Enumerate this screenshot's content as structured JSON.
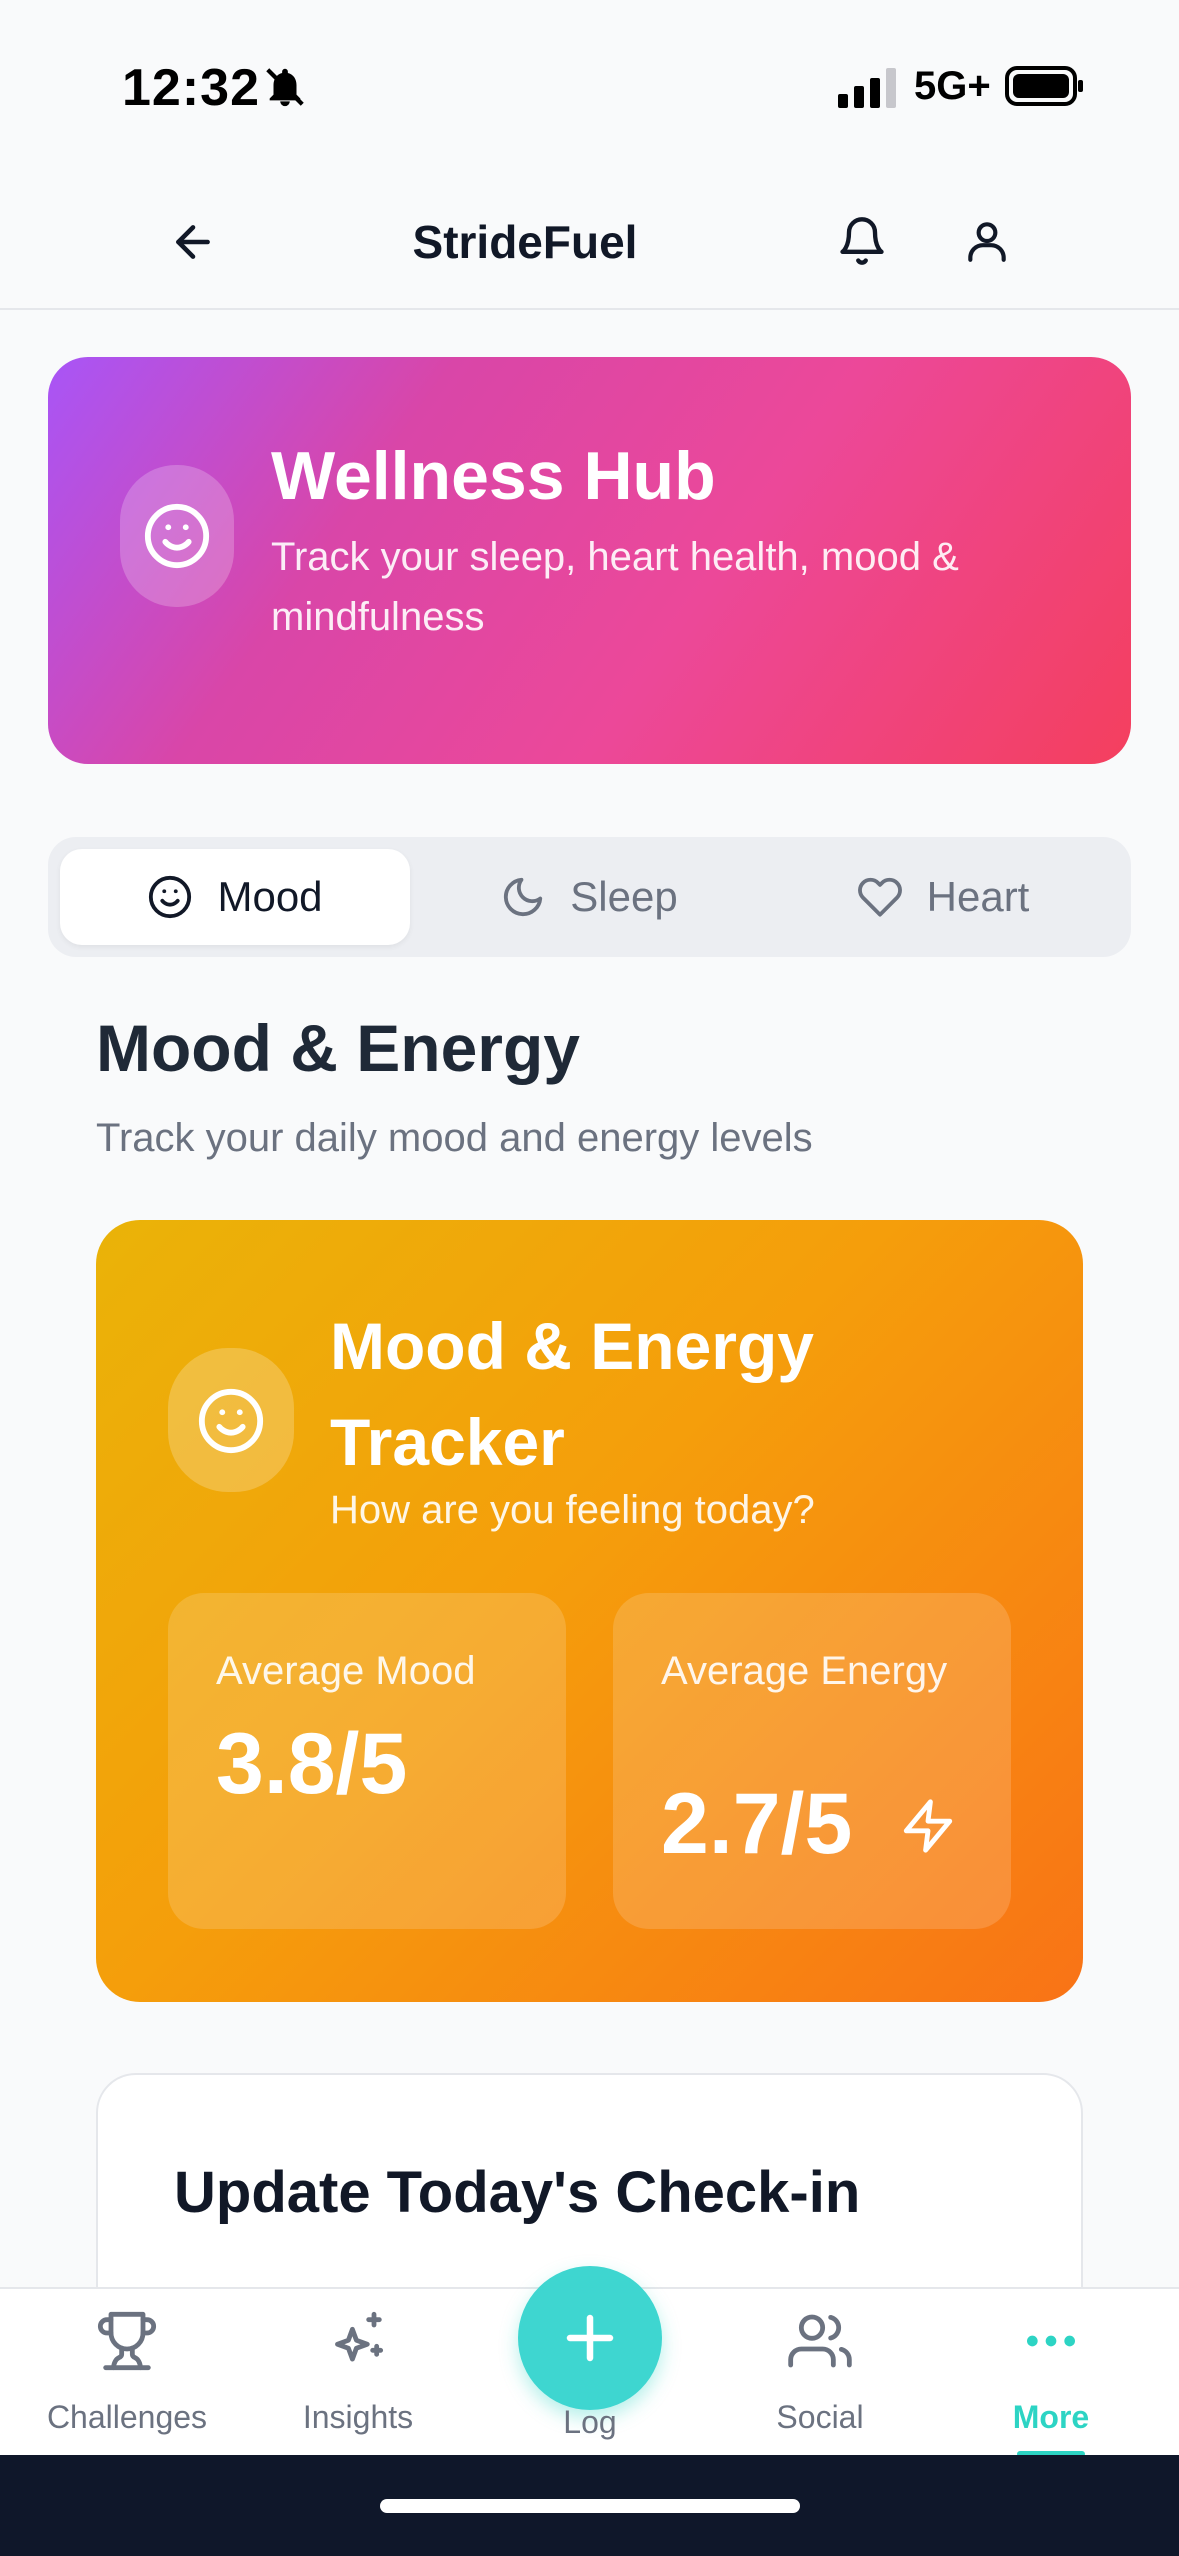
{
  "status_bar": {
    "time": "12:32",
    "network": "5G+"
  },
  "header": {
    "title": "StrideFuel"
  },
  "hero": {
    "title": "Wellness Hub",
    "subtitle": "Track your sleep, heart health, mood & mindfulness"
  },
  "tabs": [
    {
      "label": "Mood",
      "icon": "smile-icon",
      "active": true
    },
    {
      "label": "Sleep",
      "icon": "moon-icon",
      "active": false
    },
    {
      "label": "Heart",
      "icon": "heart-icon",
      "active": false
    }
  ],
  "section": {
    "title": "Mood & Energy",
    "subtitle": "Track your daily mood and energy levels"
  },
  "tracker": {
    "title": "Mood & Energy Tracker",
    "subtitle": "How are you feeling today?",
    "metrics": [
      {
        "label": "Average Mood",
        "value": "3.8/5"
      },
      {
        "label": "Average Energy",
        "value": "2.7/5"
      }
    ]
  },
  "checkin": {
    "title": "Update Today's Check-in"
  },
  "bottom_nav": {
    "items": [
      {
        "label": "Challenges",
        "icon": "trophy-icon"
      },
      {
        "label": "Insights",
        "icon": "sparkles-icon"
      },
      {
        "label": "Log",
        "icon": "plus-icon"
      },
      {
        "label": "Social",
        "icon": "users-icon"
      },
      {
        "label": "More",
        "icon": "more-dots-icon",
        "active": true
      }
    ]
  },
  "colors": {
    "accent": "#2dd4c4",
    "hero_gradient": [
      "#a855f7",
      "#ec4899",
      "#f43f5e"
    ],
    "tracker_gradient": [
      "#eab308",
      "#f59e0b",
      "#f97316"
    ]
  }
}
